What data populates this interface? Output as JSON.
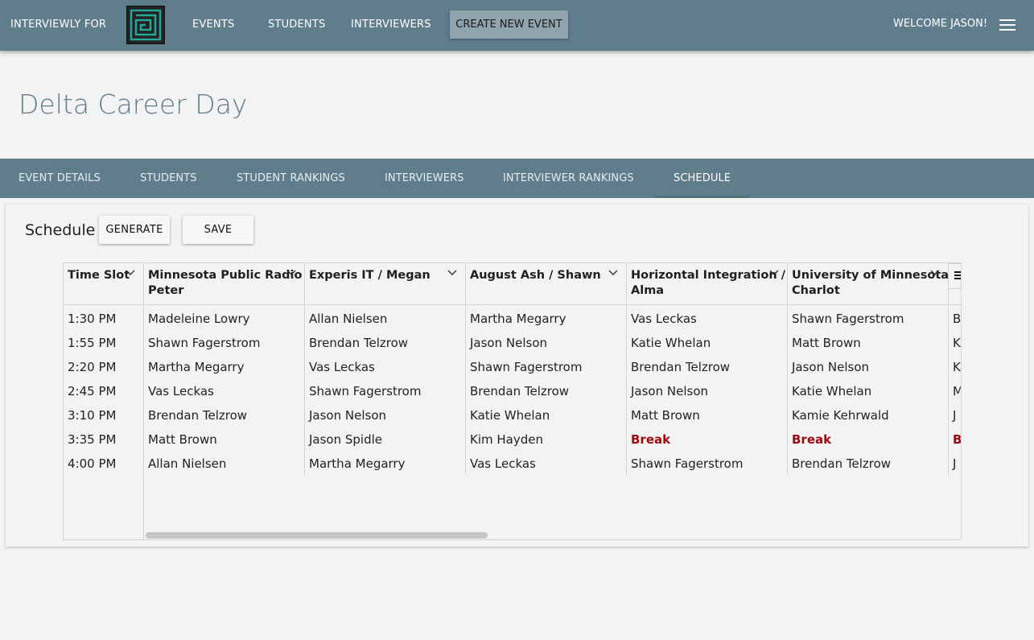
{
  "topbar": {
    "brand": "INTERVIEWLY FOR",
    "nav": [
      "EVENTS",
      "STUDENTS",
      "INTERVIEWERS"
    ],
    "create_button": "CREATE NEW EVENT",
    "welcome": "WELCOME JASON!"
  },
  "page": {
    "title": "Delta Career Day"
  },
  "tabs": [
    "EVENT DETAILS",
    "STUDENTS",
    "STUDENT RANKINGS",
    "INTERVIEWERS",
    "INTERVIEWER RANKINGS",
    "SCHEDULE"
  ],
  "schedule": {
    "title": "Schedule",
    "generate_label": "GENERATE",
    "save_label": "SAVE"
  },
  "grid": {
    "columns": [
      {
        "line1": "Time Slot",
        "line2": ""
      },
      {
        "line1": "Minnesota Public Radio /",
        "line2": "Peter"
      },
      {
        "line1": "Experis IT / Megan",
        "line2": ""
      },
      {
        "line1": "August Ash / Shawn",
        "line2": ""
      },
      {
        "line1": "Horizontal Integration /",
        "line2": "Alma"
      },
      {
        "line1": "University of Minnesota /",
        "line2": "Charlot"
      }
    ],
    "rows": [
      [
        "1:30 PM",
        "Madeleine Lowry",
        "Allan Nielsen",
        "Martha Megarry",
        "Vas Leckas",
        "Shawn Fagerstrom",
        "B"
      ],
      [
        "1:55 PM",
        "Shawn Fagerstrom",
        "Brendan Telzrow",
        "Jason Nelson",
        "Katie Whelan",
        "Matt Brown",
        "K"
      ],
      [
        "2:20 PM",
        "Martha Megarry",
        "Vas Leckas",
        "Shawn Fagerstrom",
        "Brendan Telzrow",
        "Jason Nelson",
        "K"
      ],
      [
        "2:45 PM",
        "Vas Leckas",
        "Shawn Fagerstrom",
        "Brendan Telzrow",
        "Jason Nelson",
        "Katie Whelan",
        "M"
      ],
      [
        "3:10 PM",
        "Brendan Telzrow",
        "Jason Nelson",
        "Katie Whelan",
        "Matt Brown",
        "Kamie Kehrwald",
        "J"
      ],
      [
        "3:35 PM",
        "Matt Brown",
        "Jason Spidle",
        "Kim Hayden",
        "Break",
        "Break",
        "B"
      ],
      [
        "4:00 PM",
        "Allan Nielsen",
        "Martha Megarry",
        "Vas Leckas",
        "Shawn Fagerstrom",
        "Brendan Telzrow",
        "J"
      ]
    ],
    "break_label": "Break"
  },
  "colors": {
    "primary": "#607d8b",
    "break": "#9e0b0f",
    "logo_accent": "#26a69a"
  }
}
